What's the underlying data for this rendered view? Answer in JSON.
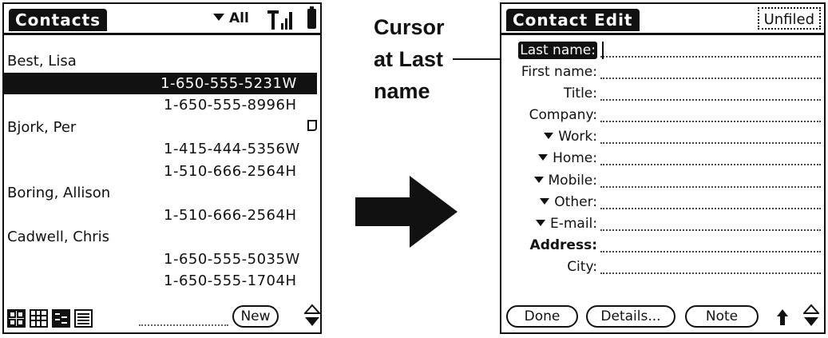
{
  "list_screen": {
    "title": "Contacts",
    "category": "All",
    "contacts": [
      {
        "name": "Best, Lisa",
        "phones": [
          {
            "number": "1-650-555-5231",
            "type": "W",
            "selected": true
          },
          {
            "number": "1-650-555-8996",
            "type": "H"
          }
        ]
      },
      {
        "name": "Bjork, Per",
        "has_note": true,
        "phones": [
          {
            "number": "1-415-444-5356",
            "type": "W"
          },
          {
            "number": "1-510-666-2564",
            "type": "H"
          }
        ]
      },
      {
        "name": "Boring, Allison",
        "phones": [
          {
            "number": "1-510-666-2564",
            "type": "H"
          }
        ]
      },
      {
        "name": "Cadwell, Chris",
        "phones": [
          {
            "number": "1-650-555-5035",
            "type": "W"
          },
          {
            "number": "1-650-555-1704",
            "type": "H"
          }
        ]
      }
    ],
    "new_label": "New"
  },
  "annotation": {
    "line1": "Cursor",
    "line2": "at Last",
    "line3": "name"
  },
  "edit_screen": {
    "title": "Contact Edit",
    "category": "Unfiled",
    "fields": [
      {
        "label": "Last name:",
        "cursor": true
      },
      {
        "label": "First name:"
      },
      {
        "label": "Title:"
      },
      {
        "label": "Company:"
      },
      {
        "label": "Work:",
        "dropdown": true
      },
      {
        "label": "Home:",
        "dropdown": true
      },
      {
        "label": "Mobile:",
        "dropdown": true
      },
      {
        "label": "Other:",
        "dropdown": true
      },
      {
        "label": "E-mail:",
        "dropdown": true
      },
      {
        "label": "Address:",
        "bold": true
      },
      {
        "label": "City:"
      }
    ],
    "buttons": {
      "done": "Done",
      "details": "Details...",
      "note": "Note"
    }
  }
}
